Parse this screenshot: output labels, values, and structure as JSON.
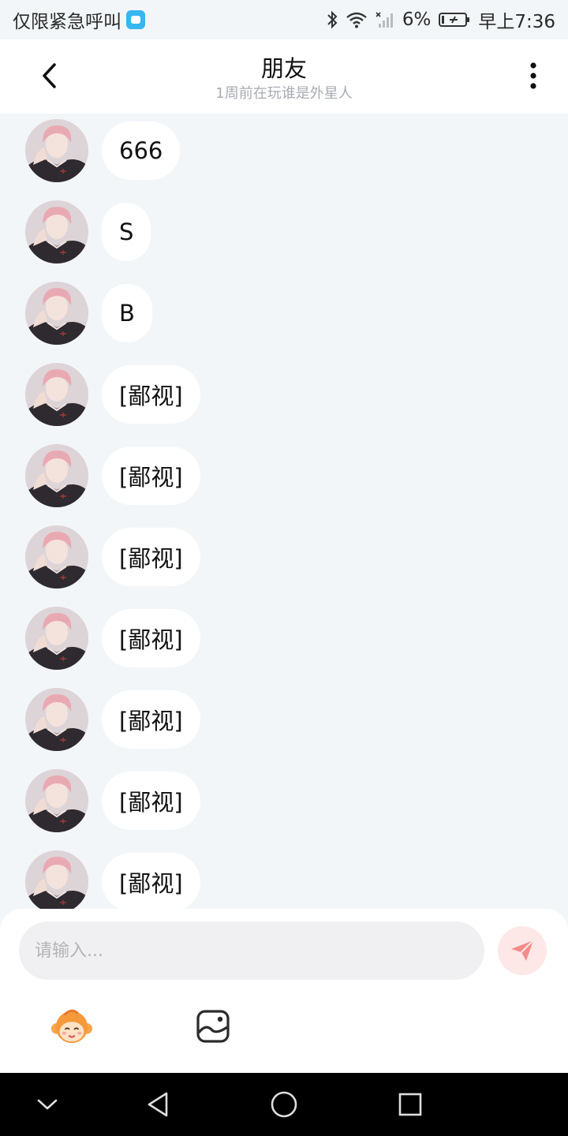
{
  "status_bar": {
    "carrier": "仅限紧急呼叫",
    "battery": "6%",
    "time": "早上7:36"
  },
  "header": {
    "title": "朋友",
    "subtitle": "1周前在玩谁是外星人"
  },
  "messages": [
    {
      "text": "666"
    },
    {
      "text": "S"
    },
    {
      "text": "B"
    },
    {
      "text": "[鄙视]"
    },
    {
      "text": "[鄙视]"
    },
    {
      "text": "[鄙视]"
    },
    {
      "text": "[鄙视]"
    },
    {
      "text": "[鄙视]"
    },
    {
      "text": "[鄙视]"
    },
    {
      "text": "[鄙视]"
    }
  ],
  "input": {
    "placeholder": "请输入..."
  },
  "icons": {
    "back": "chevron-left-icon",
    "more": "more-vertical-icon",
    "send": "paper-plane-icon",
    "emoji": "monkey-emoji-icon",
    "image": "image-icon"
  },
  "colors": {
    "background": "#f3f6f9",
    "bubble": "#ffffff",
    "send_button": "#fde7e7",
    "send_icon": "#f48b8b"
  }
}
